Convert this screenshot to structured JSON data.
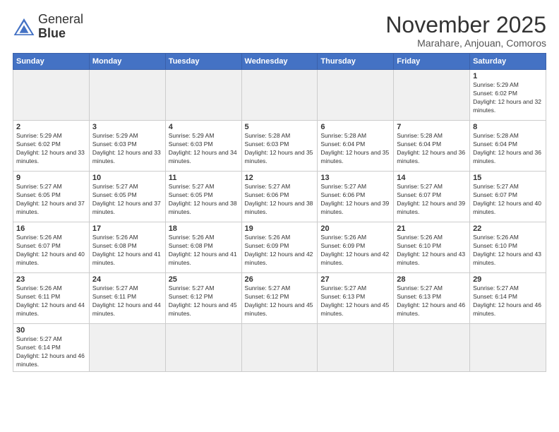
{
  "logo": {
    "text_general": "General",
    "text_blue": "Blue"
  },
  "header": {
    "month": "November 2025",
    "location": "Marahare, Anjouan, Comoros"
  },
  "weekdays": [
    "Sunday",
    "Monday",
    "Tuesday",
    "Wednesday",
    "Thursday",
    "Friday",
    "Saturday"
  ],
  "weeks": [
    [
      {
        "day": "",
        "info": ""
      },
      {
        "day": "",
        "info": ""
      },
      {
        "day": "",
        "info": ""
      },
      {
        "day": "",
        "info": ""
      },
      {
        "day": "",
        "info": ""
      },
      {
        "day": "",
        "info": ""
      },
      {
        "day": "1",
        "info": "Sunrise: 5:29 AM\nSunset: 6:02 PM\nDaylight: 12 hours and 32 minutes."
      }
    ],
    [
      {
        "day": "2",
        "info": "Sunrise: 5:29 AM\nSunset: 6:02 PM\nDaylight: 12 hours and 33 minutes."
      },
      {
        "day": "3",
        "info": "Sunrise: 5:29 AM\nSunset: 6:03 PM\nDaylight: 12 hours and 33 minutes."
      },
      {
        "day": "4",
        "info": "Sunrise: 5:29 AM\nSunset: 6:03 PM\nDaylight: 12 hours and 34 minutes."
      },
      {
        "day": "5",
        "info": "Sunrise: 5:28 AM\nSunset: 6:03 PM\nDaylight: 12 hours and 35 minutes."
      },
      {
        "day": "6",
        "info": "Sunrise: 5:28 AM\nSunset: 6:04 PM\nDaylight: 12 hours and 35 minutes."
      },
      {
        "day": "7",
        "info": "Sunrise: 5:28 AM\nSunset: 6:04 PM\nDaylight: 12 hours and 36 minutes."
      },
      {
        "day": "8",
        "info": "Sunrise: 5:28 AM\nSunset: 6:04 PM\nDaylight: 12 hours and 36 minutes."
      }
    ],
    [
      {
        "day": "9",
        "info": "Sunrise: 5:27 AM\nSunset: 6:05 PM\nDaylight: 12 hours and 37 minutes."
      },
      {
        "day": "10",
        "info": "Sunrise: 5:27 AM\nSunset: 6:05 PM\nDaylight: 12 hours and 37 minutes."
      },
      {
        "day": "11",
        "info": "Sunrise: 5:27 AM\nSunset: 6:05 PM\nDaylight: 12 hours and 38 minutes."
      },
      {
        "day": "12",
        "info": "Sunrise: 5:27 AM\nSunset: 6:06 PM\nDaylight: 12 hours and 38 minutes."
      },
      {
        "day": "13",
        "info": "Sunrise: 5:27 AM\nSunset: 6:06 PM\nDaylight: 12 hours and 39 minutes."
      },
      {
        "day": "14",
        "info": "Sunrise: 5:27 AM\nSunset: 6:07 PM\nDaylight: 12 hours and 39 minutes."
      },
      {
        "day": "15",
        "info": "Sunrise: 5:27 AM\nSunset: 6:07 PM\nDaylight: 12 hours and 40 minutes."
      }
    ],
    [
      {
        "day": "16",
        "info": "Sunrise: 5:26 AM\nSunset: 6:07 PM\nDaylight: 12 hours and 40 minutes."
      },
      {
        "day": "17",
        "info": "Sunrise: 5:26 AM\nSunset: 6:08 PM\nDaylight: 12 hours and 41 minutes."
      },
      {
        "day": "18",
        "info": "Sunrise: 5:26 AM\nSunset: 6:08 PM\nDaylight: 12 hours and 41 minutes."
      },
      {
        "day": "19",
        "info": "Sunrise: 5:26 AM\nSunset: 6:09 PM\nDaylight: 12 hours and 42 minutes."
      },
      {
        "day": "20",
        "info": "Sunrise: 5:26 AM\nSunset: 6:09 PM\nDaylight: 12 hours and 42 minutes."
      },
      {
        "day": "21",
        "info": "Sunrise: 5:26 AM\nSunset: 6:10 PM\nDaylight: 12 hours and 43 minutes."
      },
      {
        "day": "22",
        "info": "Sunrise: 5:26 AM\nSunset: 6:10 PM\nDaylight: 12 hours and 43 minutes."
      }
    ],
    [
      {
        "day": "23",
        "info": "Sunrise: 5:26 AM\nSunset: 6:11 PM\nDaylight: 12 hours and 44 minutes."
      },
      {
        "day": "24",
        "info": "Sunrise: 5:27 AM\nSunset: 6:11 PM\nDaylight: 12 hours and 44 minutes."
      },
      {
        "day": "25",
        "info": "Sunrise: 5:27 AM\nSunset: 6:12 PM\nDaylight: 12 hours and 45 minutes."
      },
      {
        "day": "26",
        "info": "Sunrise: 5:27 AM\nSunset: 6:12 PM\nDaylight: 12 hours and 45 minutes."
      },
      {
        "day": "27",
        "info": "Sunrise: 5:27 AM\nSunset: 6:13 PM\nDaylight: 12 hours and 45 minutes."
      },
      {
        "day": "28",
        "info": "Sunrise: 5:27 AM\nSunset: 6:13 PM\nDaylight: 12 hours and 46 minutes."
      },
      {
        "day": "29",
        "info": "Sunrise: 5:27 AM\nSunset: 6:14 PM\nDaylight: 12 hours and 46 minutes."
      }
    ],
    [
      {
        "day": "30",
        "info": "Sunrise: 5:27 AM\nSunset: 6:14 PM\nDaylight: 12 hours and 46 minutes."
      },
      {
        "day": "",
        "info": ""
      },
      {
        "day": "",
        "info": ""
      },
      {
        "day": "",
        "info": ""
      },
      {
        "day": "",
        "info": ""
      },
      {
        "day": "",
        "info": ""
      },
      {
        "day": "",
        "info": ""
      }
    ]
  ]
}
